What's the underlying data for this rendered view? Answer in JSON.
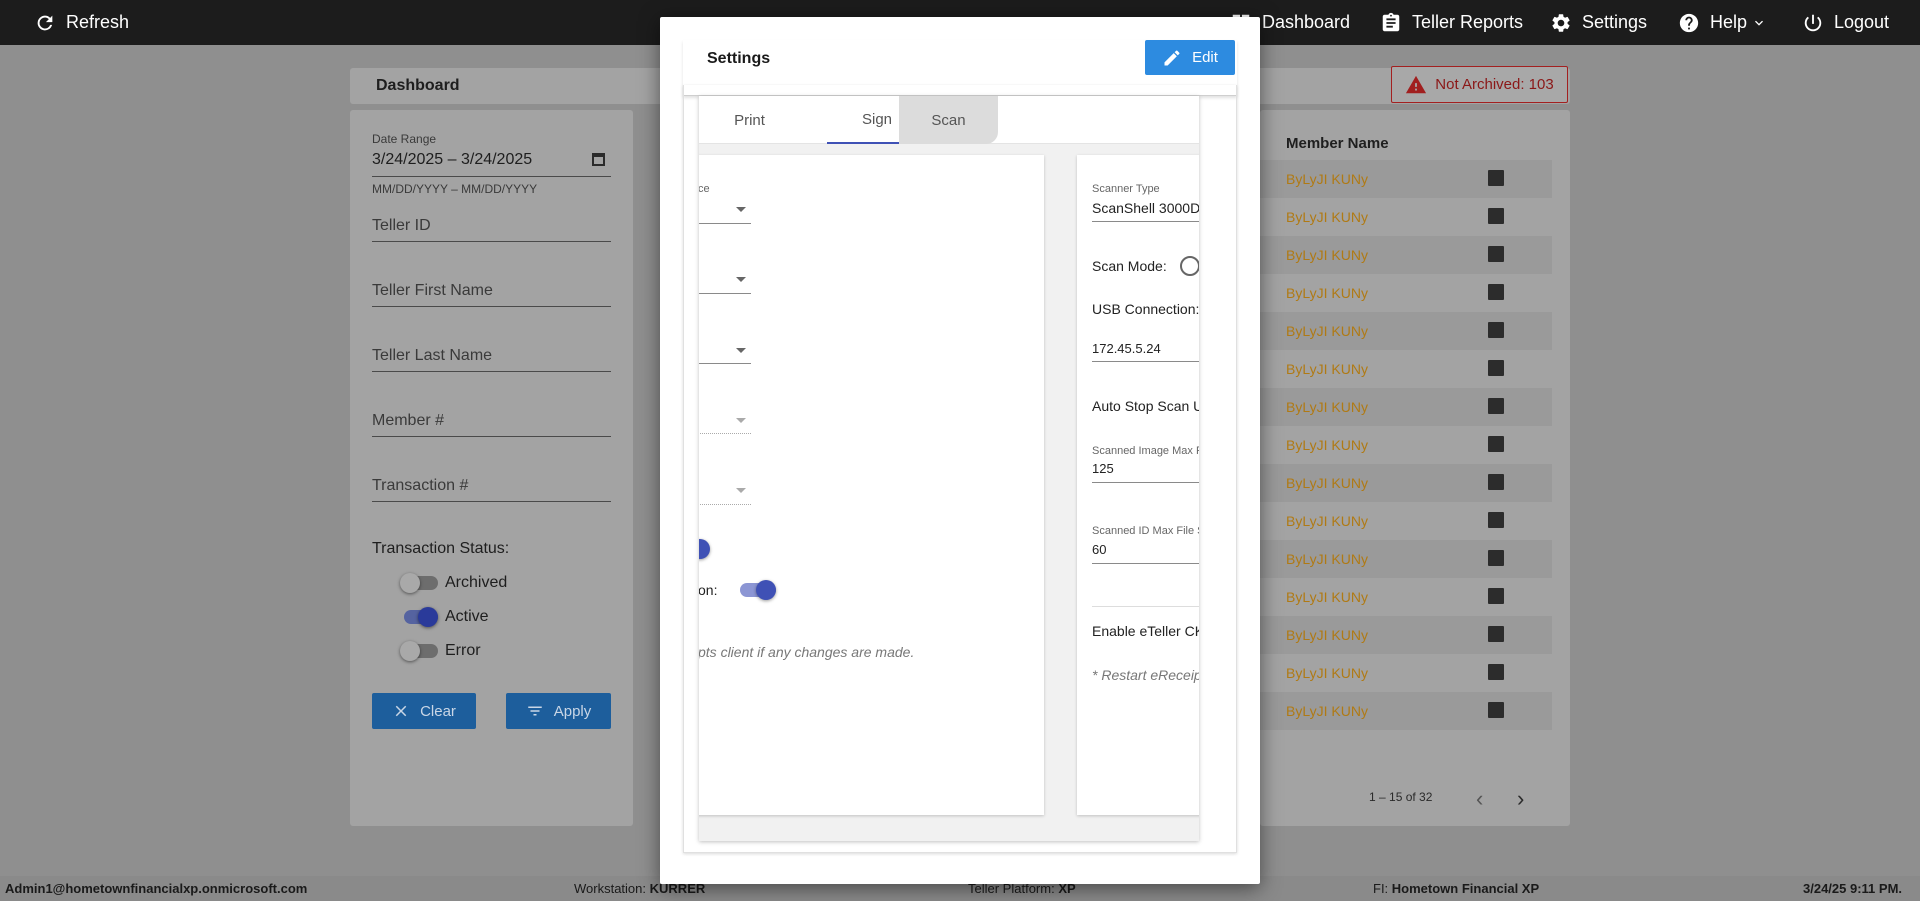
{
  "topbar": {
    "refresh": "Refresh",
    "dashboard": "Dashboard",
    "teller_reports": "Teller Reports",
    "settings": "Settings",
    "help": "Help",
    "logout": "Logout"
  },
  "dashboard": {
    "title": "Dashboard",
    "date_range_label": "Date Range",
    "date_range_value": "3/24/2025 – 3/24/2025",
    "date_range_hint": "MM/DD/YYYY – MM/DD/YYYY",
    "teller_id": "Teller ID",
    "teller_first_name": "Teller First Name",
    "teller_last_name": "Teller Last Name",
    "member_number": "Member #",
    "transaction_number": "Transaction #",
    "transaction_status_label": "Transaction Status:",
    "status_archived": "Archived",
    "status_active": "Active",
    "status_error": "Error",
    "status_archived_on": false,
    "status_active_on": true,
    "status_error_on": false,
    "clear_label": "Clear",
    "apply_label": "Apply",
    "not_archived_badge": "Not Archived: 103",
    "member_name_header": "Member Name",
    "rows": [
      "ByLyJI KUNy",
      "ByLyJI KUNy",
      "ByLyJI KUNy",
      "ByLyJI KUNy",
      "ByLyJI KUNy",
      "ByLyJI KUNy",
      "ByLyJI KUNy",
      "ByLyJI KUNy",
      "ByLyJI KUNy",
      "ByLyJI KUNy",
      "ByLyJI KUNy",
      "ByLyJI KUNy",
      "ByLyJI KUNy",
      "ByLyJI KUNy",
      "ByLyJI KUNy"
    ],
    "pager_text": "1 – 15 of 32"
  },
  "modal": {
    "title": "Settings",
    "edit_label": "Edit",
    "tabs": [
      "Print",
      "Sign",
      "Scan"
    ],
    "active_tab": "Sign",
    "left_panel": {
      "label_partial": "ce",
      "toggle_partial_label": "on:",
      "restart_note_partial": "pts client if any changes are made."
    },
    "right_panel": {
      "scanner_type_label": "Scanner Type",
      "scanner_type_value": "ScanShell 3000D",
      "scan_mode_label": "Scan Mode:",
      "usb_connection_label": "USB Connection:",
      "ip_value": "172.45.5.24",
      "auto_stop_label": "Auto Stop Scan U",
      "scanned_image_max_label": "Scanned Image Max Fi",
      "scanned_image_max_value": "125",
      "scanned_id_max_label": "Scanned ID Max File S",
      "scanned_id_max_value": "60",
      "enable_eteller_label": "Enable eTeller CK",
      "restart_note": "* Restart eReceip"
    }
  },
  "statusbar": {
    "user": "Admin1@hometownfinancialxp.onmicrosoft.com",
    "workstation_label": "Workstation:",
    "workstation_value": "KURRER",
    "platform_label": "Teller Platform:",
    "platform_value": "XP",
    "fi_label": "FI:",
    "fi_value": "Hometown Financial XP",
    "datetime": "3/24/25 9:11 PM."
  }
}
